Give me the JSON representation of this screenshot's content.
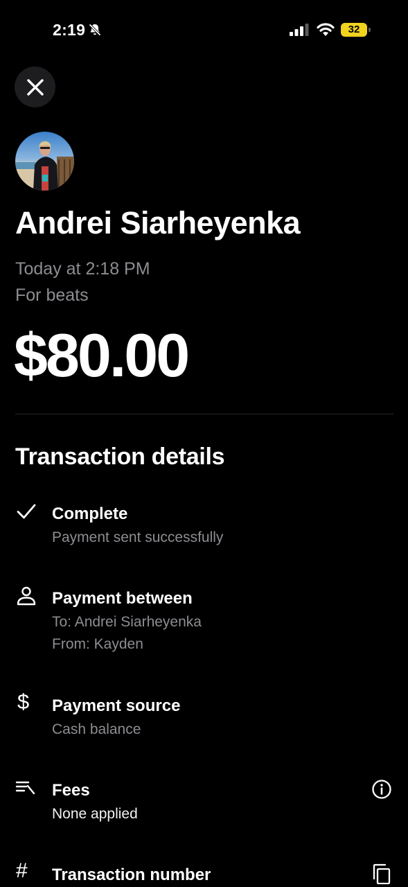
{
  "status_bar": {
    "time": "2:19",
    "battery": "32",
    "icons": [
      "bell-slash-icon",
      "cellular-signal-icon",
      "wifi-icon",
      "battery-icon"
    ],
    "battery_color": "#f1d21f"
  },
  "header": {
    "close_icon": "close-icon",
    "recipient_name": "Andrei Siarheyenka",
    "timestamp": "Today at 2:18 PM",
    "memo": "For beats",
    "amount": "$80.00"
  },
  "details": {
    "title": "Transaction details",
    "status": {
      "icon": "checkmark-icon",
      "title": "Complete",
      "subtitle": "Payment sent successfully"
    },
    "between": {
      "icon": "person-icon",
      "title": "Payment between",
      "to": "To: Andrei Siarheyenka",
      "from": "From: Kayden"
    },
    "source": {
      "icon": "dollar-icon",
      "title": "Payment source",
      "subtitle": "Cash balance"
    },
    "fees": {
      "icon": "fees-icon",
      "title": "Fees",
      "subtitle": "None applied",
      "action_icon": "info-icon"
    },
    "number": {
      "icon": "hash-icon",
      "title": "Transaction number",
      "action_icon": "copy-icon"
    }
  },
  "colors": {
    "background": "#000000",
    "text": "#ffffff",
    "secondary_text": "#8d8d92",
    "divider": "#2a2a2c",
    "close_button_bg": "#1d1d1f"
  }
}
